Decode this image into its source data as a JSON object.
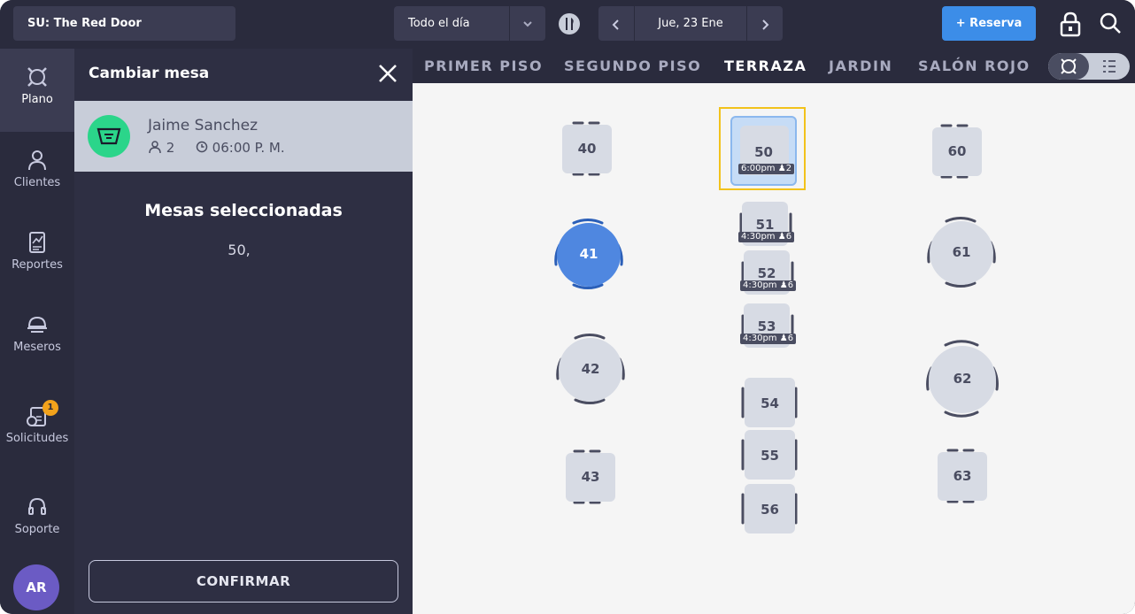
{
  "topbar": {
    "venue": "SU: The Red Door",
    "shift": "Todo el día",
    "date": "Jue, 23 Ene",
    "reserve_label": "+ Reserva"
  },
  "nav": {
    "items": [
      {
        "label": "Plano",
        "icon": "floorplan-icon"
      },
      {
        "label": "Clientes",
        "icon": "person-icon"
      },
      {
        "label": "Reportes",
        "icon": "report-icon"
      },
      {
        "label": "Meseros",
        "icon": "waiter-icon"
      },
      {
        "label": "Solicitudes",
        "icon": "requests-icon",
        "badge": "1"
      },
      {
        "label": "Soporte",
        "icon": "headset-icon"
      }
    ],
    "avatar": "AR"
  },
  "panel": {
    "title": "Cambiar mesa",
    "guest_name": "Jaime Sanchez",
    "guest_party": "2",
    "guest_time": "06:00 P. M.",
    "selected_heading": "Mesas seleccionadas",
    "selected_value": "50,",
    "confirm_label": "CONFIRMAR"
  },
  "floors": {
    "tabs": [
      "PRIMER PISO",
      "SEGUNDO PISO",
      "TERRAZA",
      "JARDIN",
      "SALÓN ROJO"
    ],
    "active": "TERRAZA"
  },
  "tables": {
    "t40": "40",
    "t41": "41",
    "t42": "42",
    "t43": "43",
    "t50": "50",
    "t50_tag": "6:00pm",
    "t50_party": "2",
    "t51": "51",
    "t51_tag": "4:30pm",
    "t51_party": "6",
    "t52": "52",
    "t52_tag": "4:30pm",
    "t52_party": "6",
    "t53": "53",
    "t53_tag": "4:30pm",
    "t53_party": "6",
    "t54": "54",
    "t55": "55",
    "t56": "56",
    "t60": "60",
    "t61": "61",
    "t62": "62",
    "t63": "63"
  },
  "colors": {
    "sidebar": "#2a2b3d",
    "accent": "#3c8de8",
    "selected_table": "#4f87e0",
    "highlight": "#f2c21b",
    "guest_icon": "#2bd58a"
  }
}
